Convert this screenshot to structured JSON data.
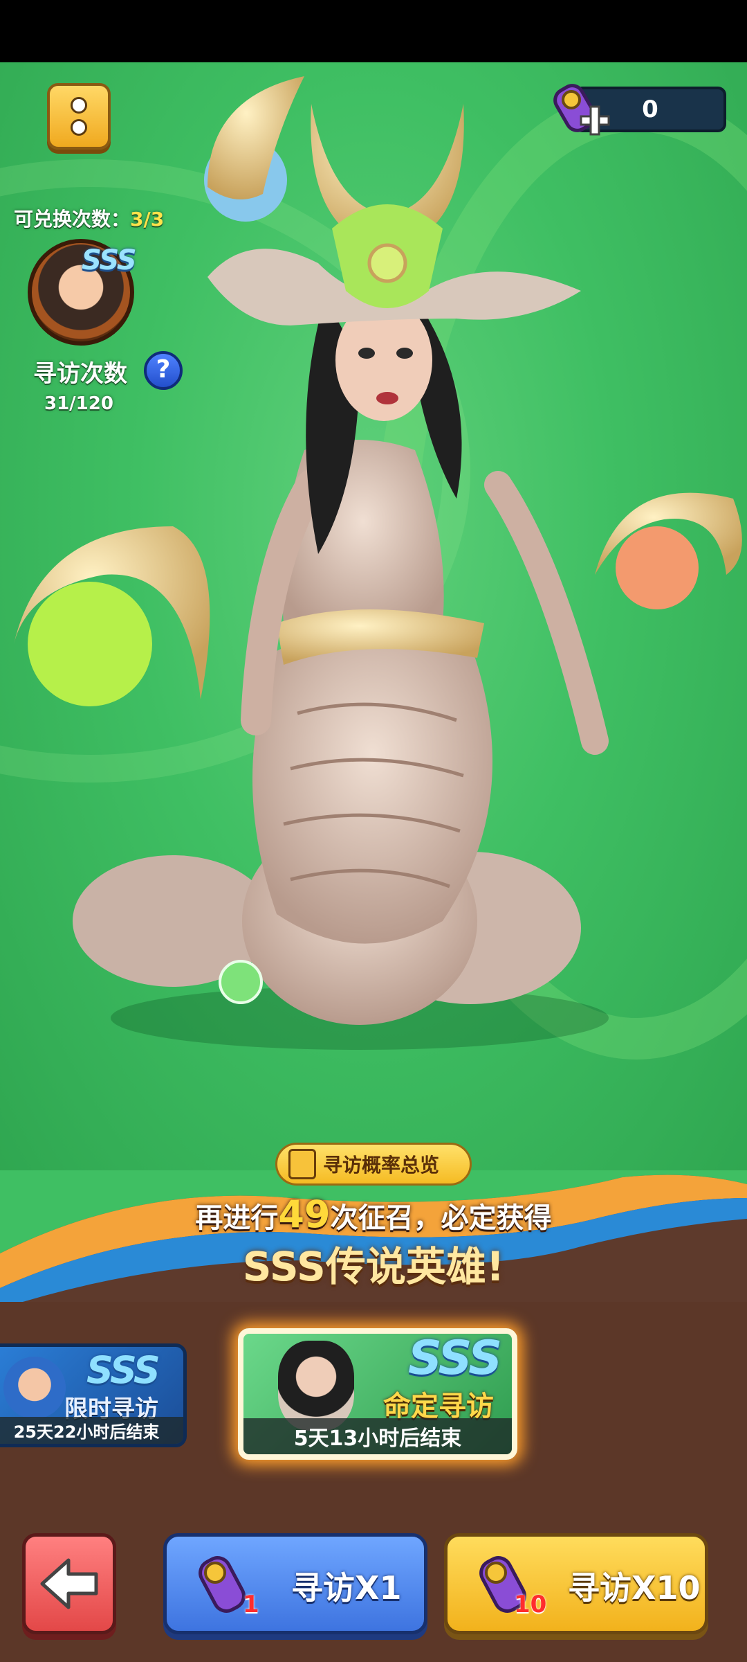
{
  "top": {
    "currency_value": "0",
    "exchange_label": "可兑换次数：",
    "exchange_count": "3/3"
  },
  "hero_card": {
    "rarity": "SSS",
    "visit_label": "寻访次数",
    "help_symbol": "?",
    "visit_progress": "31/120"
  },
  "summon": {
    "probability_button": "寻访概率总览",
    "pity_prefix": "再进行",
    "pity_count": "49",
    "pity_suffix": "次征召，必定获得",
    "pity_reward": "SSS传说英雄!"
  },
  "banners": [
    {
      "rarity": "SSS",
      "title": "限时寻访",
      "time": "25天22小时后结束"
    },
    {
      "rarity": "SSS",
      "title": "命定寻访",
      "time": "5天13小时后结束"
    }
  ],
  "actions": {
    "visit_x1": {
      "label": "寻访X1",
      "cost": "1"
    },
    "visit_x10": {
      "label": "寻访X10",
      "cost": "10"
    }
  },
  "colors": {
    "accent_gold": "#ffd93a",
    "stage_green": "#3fbf63",
    "bottom_brown": "#5c3728"
  }
}
